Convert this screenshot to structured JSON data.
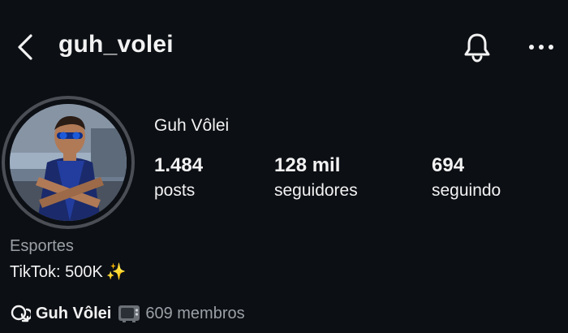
{
  "header": {
    "username": "guh_volei",
    "back_icon": "chevron-left-icon",
    "notification_icon": "bell-icon",
    "more_icon": "more-horizontal-icon"
  },
  "profile": {
    "display_name": "Guh Vôlei",
    "stats": [
      {
        "value": "1.484",
        "label": "posts"
      },
      {
        "value": "128 mil",
        "label": "seguidores"
      },
      {
        "value": "694",
        "label": "seguindo"
      }
    ],
    "category": "Esportes",
    "bio": "TikTok: 500K",
    "bio_emoji": "✨"
  },
  "channel": {
    "icon": "broadcast-channel-icon",
    "name": "Guh Vôlei",
    "emoji_icon": "television-icon",
    "members": "609 membros"
  },
  "colors": {
    "background": "#0c0f14",
    "text": "#f2f2f2",
    "muted": "#9aa0a6",
    "ring": "#4b4f55"
  }
}
